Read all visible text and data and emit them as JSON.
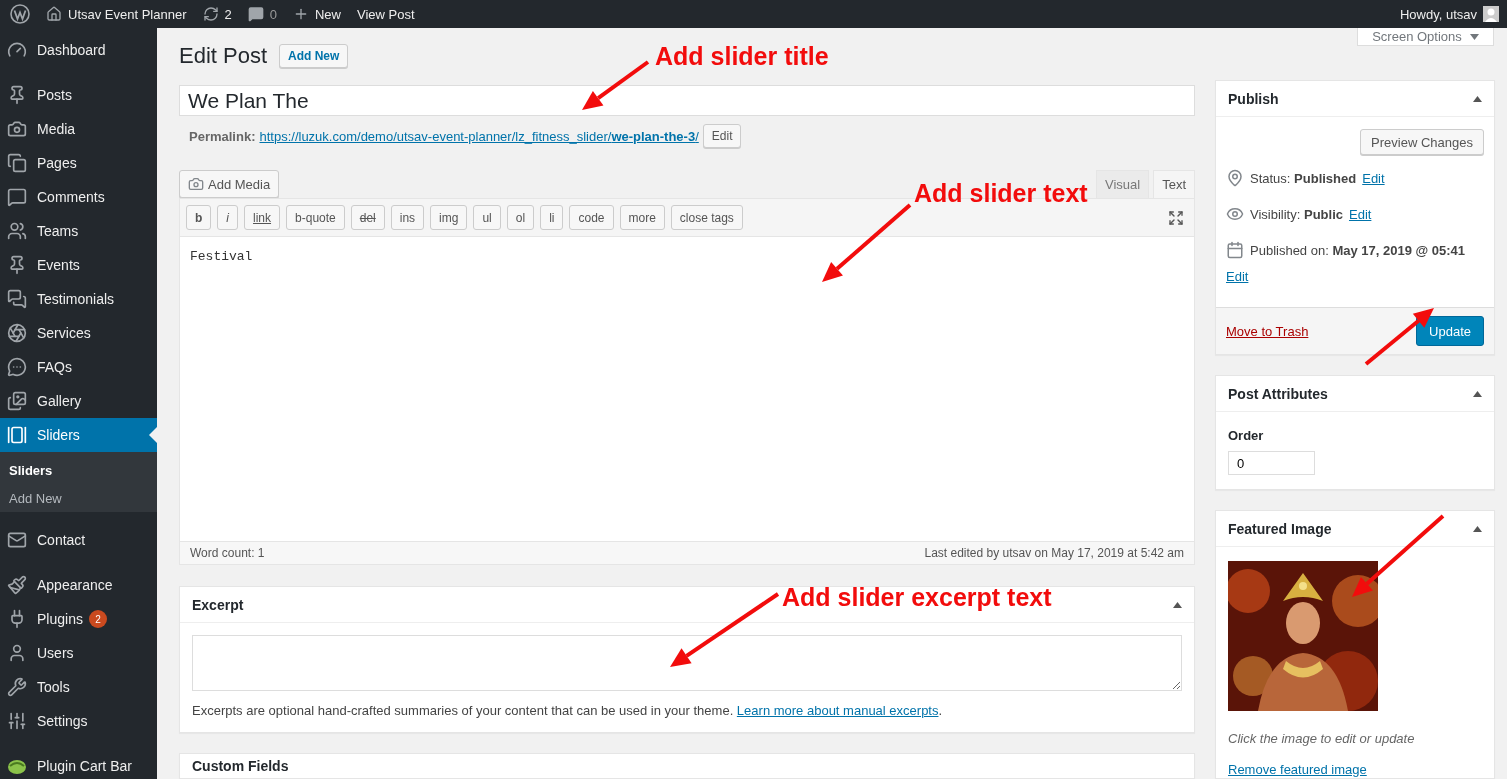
{
  "admin_bar": {
    "site_name": "Utsav Event Planner",
    "updates_count": "2",
    "comments_count": "0",
    "new_label": "New",
    "view_post": "View Post",
    "greeting": "Howdy, utsav"
  },
  "sidebar": {
    "groups": [
      [
        {
          "label": "Dashboard",
          "selected": false
        }
      ],
      [
        {
          "label": "Posts",
          "selected": false
        },
        {
          "label": "Media",
          "selected": false
        },
        {
          "label": "Pages",
          "selected": false
        },
        {
          "label": "Comments",
          "selected": false
        },
        {
          "label": "Teams",
          "selected": false
        },
        {
          "label": "Events",
          "selected": false
        },
        {
          "label": "Testimonials",
          "selected": false
        },
        {
          "label": "Services",
          "selected": false
        },
        {
          "label": "FAQs",
          "selected": false
        },
        {
          "label": "Gallery",
          "selected": false
        },
        {
          "label": "Sliders",
          "selected": true,
          "children": [
            {
              "label": "Sliders",
              "selected": true
            },
            {
              "label": "Add New",
              "selected": false
            }
          ]
        }
      ],
      [
        {
          "label": "Contact",
          "selected": false
        }
      ],
      [
        {
          "label": "Appearance",
          "selected": false
        },
        {
          "label": "Plugins",
          "selected": false,
          "badge": "2"
        },
        {
          "label": "Users",
          "selected": false
        },
        {
          "label": "Tools",
          "selected": false
        },
        {
          "label": "Settings",
          "selected": false
        }
      ],
      [
        {
          "label": "Plugin Cart Bar",
          "selected": false
        }
      ]
    ]
  },
  "screen_options": "Screen Options",
  "heading": "Edit Post",
  "add_new": "Add New",
  "title_field": {
    "value": "We Plan The"
  },
  "permalink": {
    "label": "Permalink:",
    "url_base": "https://luzuk.com/demo/utsav-event-planner/lz_fitness_slider/",
    "url_slug": "we-plan-the-3",
    "url_tail": "/",
    "edit": "Edit"
  },
  "editor": {
    "add_media": "Add Media",
    "tabs": [
      {
        "label": "Visual",
        "selected": false
      },
      {
        "label": "Text",
        "selected": true
      }
    ],
    "quicktags": [
      "b",
      "i",
      "link",
      "b-quote",
      "del",
      "ins",
      "img",
      "ul",
      "ol",
      "li",
      "code",
      "more",
      "close tags"
    ],
    "content": "Festival",
    "word_count": "Word count: 1",
    "last_edited": "Last edited by utsav on May 17, 2019 at 5:42 am"
  },
  "excerpt": {
    "title": "Excerpt",
    "help": "Excerpts are optional hand-crafted summaries of your content that can be used in your theme. ",
    "link": "Learn more about manual excerpts",
    "tail": "."
  },
  "custom_fields": {
    "title": "Custom Fields"
  },
  "publish": {
    "title": "Publish",
    "preview": "Preview Changes",
    "rows": [
      {
        "label": "Status:",
        "value": "Published",
        "edit": "Edit"
      },
      {
        "label": "Visibility:",
        "value": "Public",
        "edit": "Edit"
      },
      {
        "label": "Published on:",
        "value": "May 17, 2019 @ 05:41",
        "edit": "Edit"
      }
    ],
    "trash": "Move to Trash",
    "update": "Update"
  },
  "post_attributes": {
    "title": "Post Attributes",
    "order_label": "Order",
    "order_value": "0"
  },
  "featured_image": {
    "title": "Featured Image",
    "caption": "Click the image to edit or update",
    "remove": "Remove featured image"
  },
  "annotations": [
    "Add slider title",
    "Add slider text",
    "Add slider excerpt text"
  ]
}
